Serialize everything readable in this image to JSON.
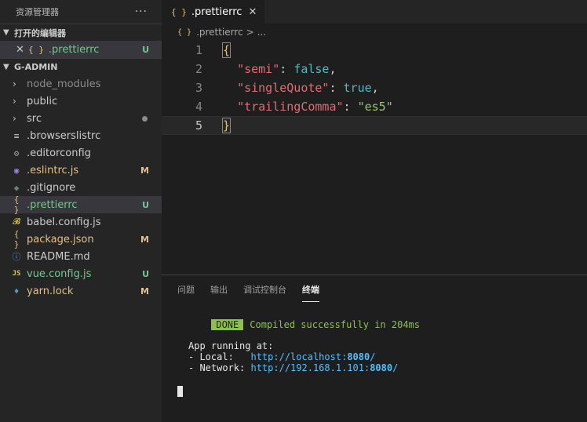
{
  "sidebar": {
    "title": "资源管理器",
    "more": "···",
    "open_editors": {
      "label": "打开的编辑器",
      "items": [
        {
          "icon": "{ }",
          "name": ".prettierrc",
          "badge": "U"
        }
      ]
    },
    "project": {
      "label": "G-ADMIN",
      "items": [
        {
          "name": "node_modules",
          "type": "folder",
          "icon": "chevron-right-icon"
        },
        {
          "name": "public",
          "type": "folder",
          "icon": "chevron-right-icon"
        },
        {
          "name": "src",
          "type": "folder",
          "icon": "chevron-right-icon",
          "dot": true
        },
        {
          "name": ".browserslistrc",
          "icon": "≡"
        },
        {
          "name": ".editorconfig",
          "icon": "⚙"
        },
        {
          "name": ".eslintrc.js",
          "icon": "◉",
          "badge": "M"
        },
        {
          "name": ".gitignore",
          "icon": "◆"
        },
        {
          "name": ".prettierrc",
          "icon": "{ }",
          "badge": "U"
        },
        {
          "name": "babel.config.js",
          "icon": "𝓑"
        },
        {
          "name": "package.json",
          "icon": "{ }",
          "badge": "M"
        },
        {
          "name": "README.md",
          "icon": "ⓘ"
        },
        {
          "name": "vue.config.js",
          "icon": "JS",
          "badge": "U"
        },
        {
          "name": "yarn.lock",
          "icon": "🧶",
          "badge": "M"
        }
      ]
    }
  },
  "editor": {
    "tab": {
      "icon": "{ }",
      "name": ".prettierrc",
      "close": "✕"
    },
    "breadcrumb": {
      "icon": "{ }",
      "file": ".prettierrc",
      "sep": ">",
      "more": "..."
    },
    "lines": [
      {
        "n": "1",
        "text": "{"
      },
      {
        "n": "2",
        "key": "\"semi\"",
        "colon": ": ",
        "val": "false",
        "tail": ","
      },
      {
        "n": "3",
        "key": "\"singleQuote\"",
        "colon": ": ",
        "val": "true",
        "tail": ","
      },
      {
        "n": "4",
        "key": "\"trailingComma\"",
        "colon": ": ",
        "val": "\"es5\"",
        "tail": ""
      },
      {
        "n": "5",
        "text": "}"
      }
    ]
  },
  "panel": {
    "tabs": [
      "问题",
      "输出",
      "调试控制台",
      "终端"
    ],
    "active_tab": "终端",
    "terminal": {
      "done": "DONE",
      "compiled": "Compiled successfully in 204ms",
      "app_running": "App running at:",
      "local_label": "- Local:   ",
      "local_url": "http://localhost:",
      "local_port": "8080",
      "network_label": "- Network: ",
      "network_url": "http://192.168.1.101:",
      "network_port": "8080",
      "slash": "/"
    }
  },
  "colors": {
    "modified": "#e2c08d",
    "untracked": "#73c991",
    "done_bg": "#8bc34a"
  }
}
